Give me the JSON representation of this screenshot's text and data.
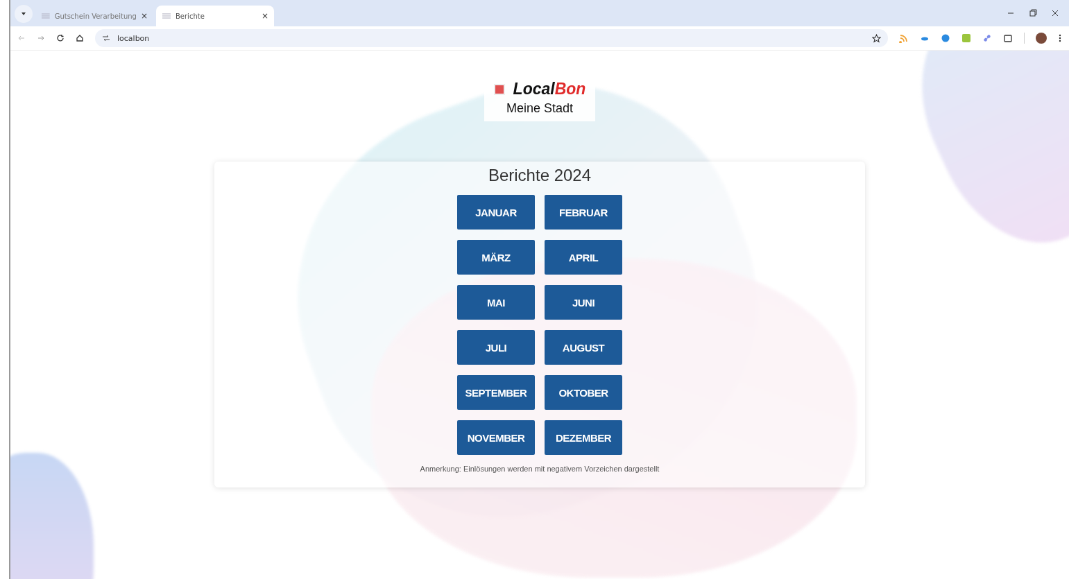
{
  "browser": {
    "tabs": [
      {
        "title": "Gutschein Verarbeitung",
        "selected": false
      },
      {
        "title": "Berichte",
        "selected": true
      }
    ],
    "tab_close": "×",
    "address": "localbon"
  },
  "header": {
    "logo_part_1": "Local",
    "logo_part_2": "Bon",
    "subtitle": "Meine Stadt"
  },
  "report": {
    "title": "Berichte 2024",
    "months": [
      "JANUAR",
      "FEBRUAR",
      "MÄRZ",
      "APRIL",
      "MAI",
      "JUNI",
      "JULI",
      "AUGUST",
      "SEPTEMBER",
      "OKTOBER",
      "NOVEMBER",
      "DEZEMBER"
    ],
    "note": "Anmerkung: Einlösungen werden mit negativem Vorzeichen dargestellt"
  }
}
